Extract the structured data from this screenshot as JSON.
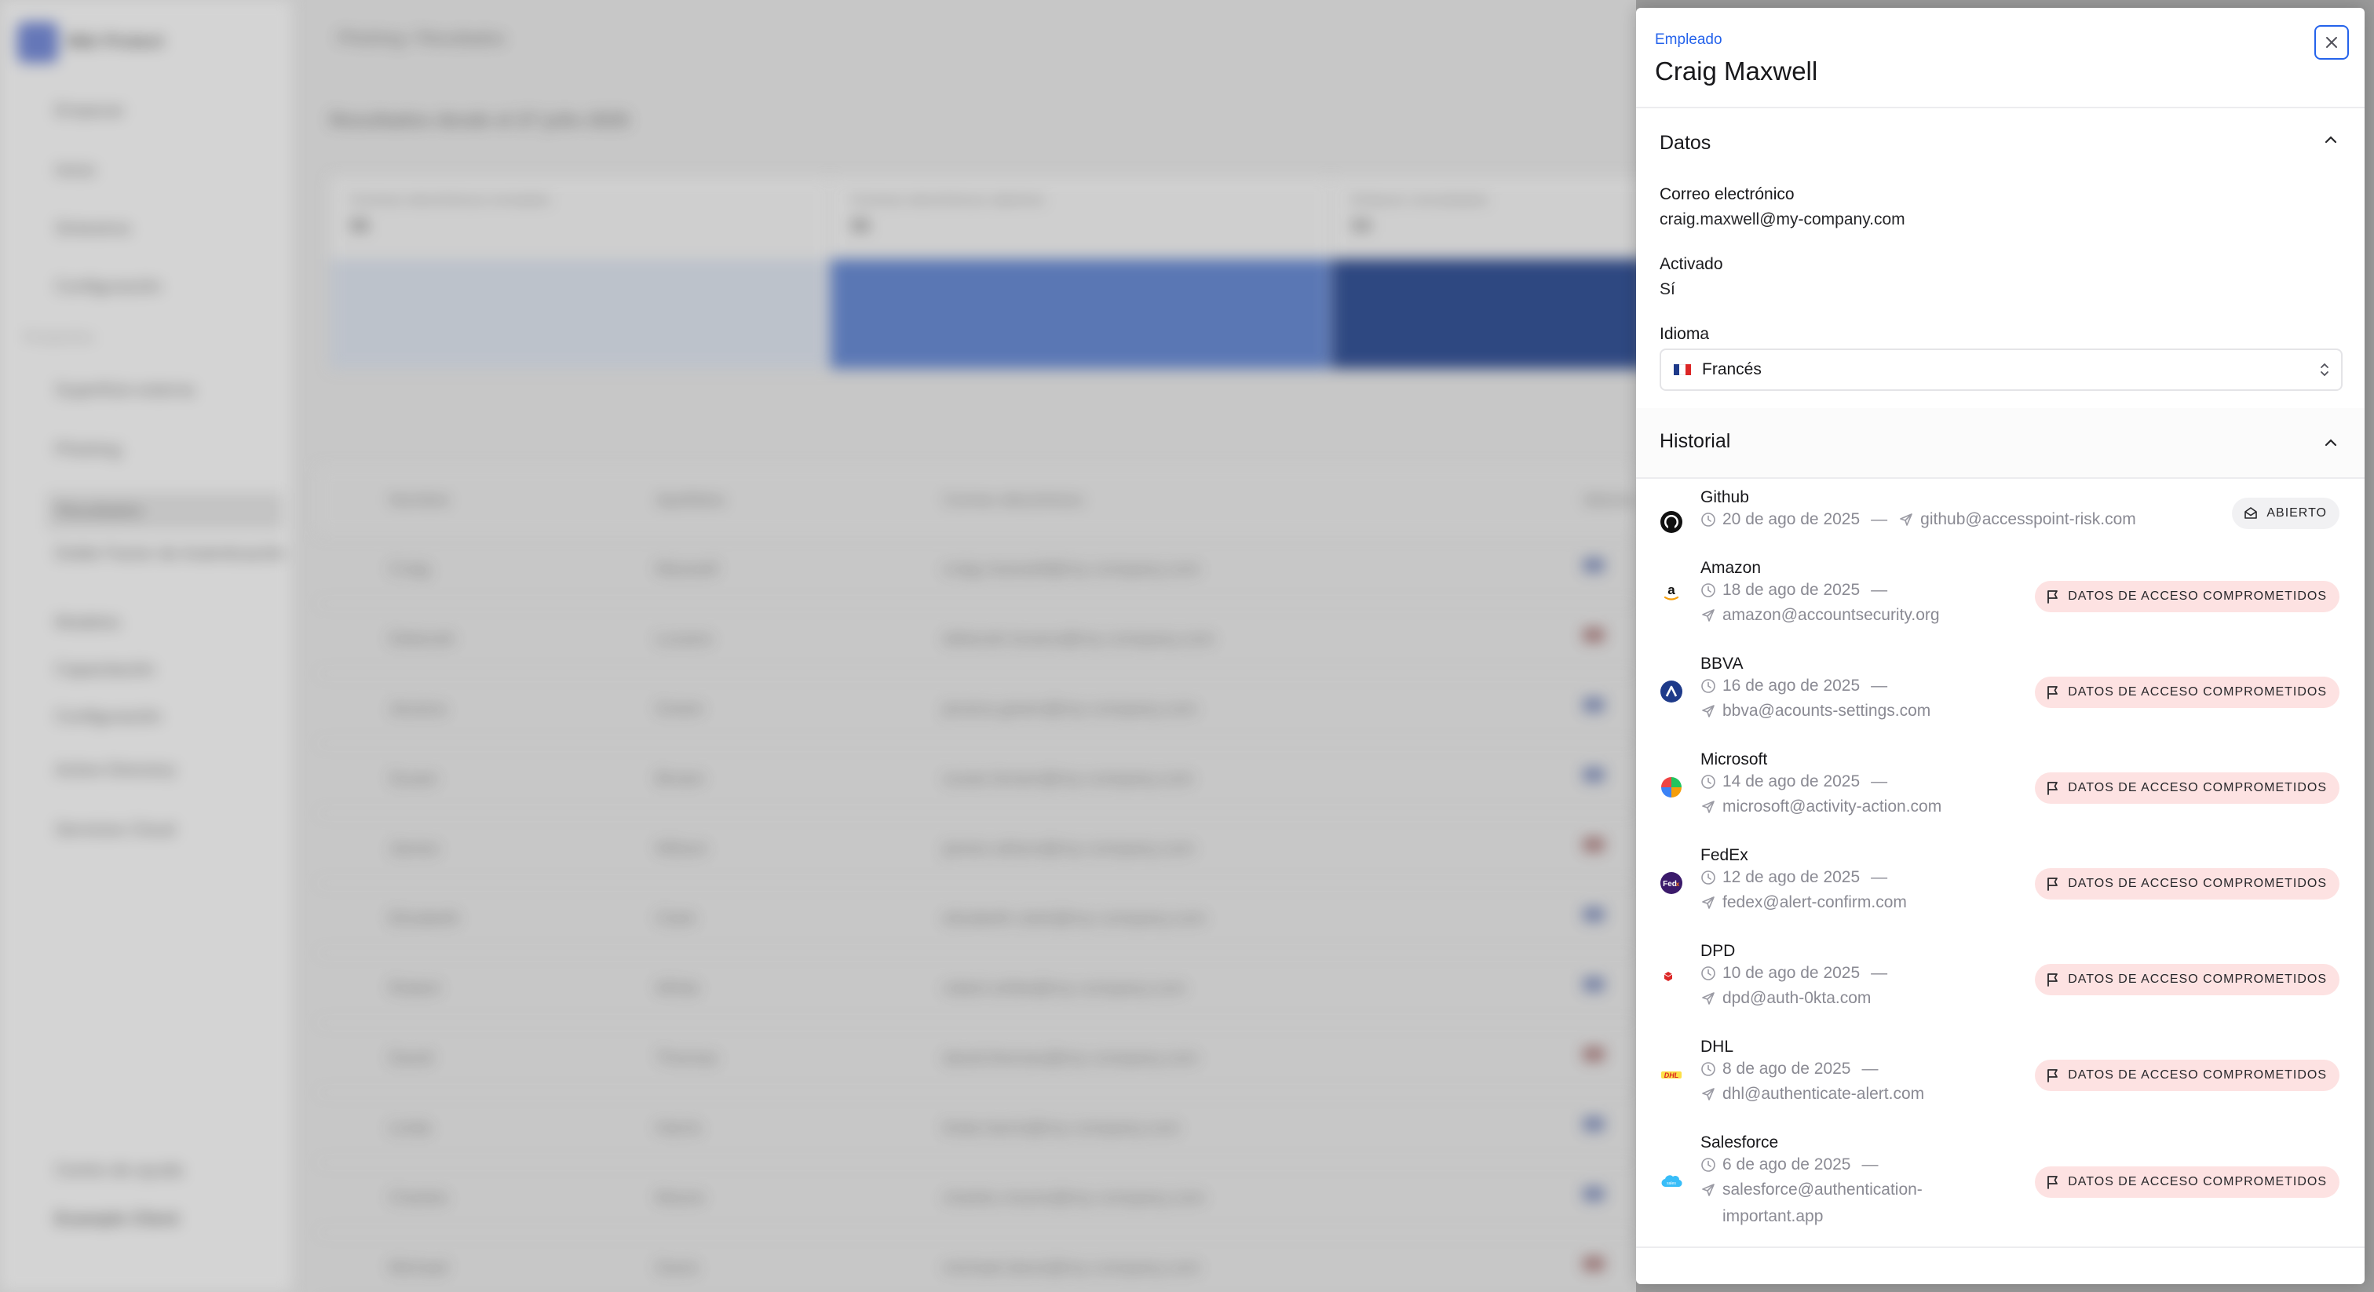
{
  "background": {
    "app_name": "Mdr Protect",
    "breadcrumb": "Phishing / Resultados",
    "nav": [
      "Empezar",
      "Inicio",
      "Siniestros",
      "Configuración",
      "Perspectiva",
      "Superficie externa",
      "Phishing",
      "Resultados",
      "Doble Factor de Autenticación",
      "Modelos",
      "Capacitación",
      "Configuración",
      "Active Directory",
      "Servicios Cloud"
    ],
    "help": "Centro de ayuda",
    "client_name": "Example Client",
    "main_title": "Resultados desde el 27 julio 2025",
    "stats": [
      {
        "label": "Correos electrónicos enviados",
        "value": "96"
      },
      {
        "label": "Correos electrónicos abiertos",
        "value": "96"
      },
      {
        "label": "Enlaces consultados",
        "value": "94"
      }
    ],
    "columns": [
      "Nombre",
      "Apellidos",
      "Correo electrónico",
      "Idioma"
    ],
    "rows": [
      [
        "Craig",
        "Maxwell",
        "craig.maxwell@my-company.com"
      ],
      [
        "Deborah",
        "Lozano",
        "deborah.lozano@my-company.com"
      ],
      [
        "Jessica",
        "Green",
        "jessica.green@my-company.com"
      ],
      [
        "Susan",
        "Brown",
        "susan.brown@my-company.com"
      ],
      [
        "James",
        "Wilson",
        "james.wilson@my-company.com"
      ],
      [
        "Elizabeth",
        "Clark",
        "elizabeth.clark@my-company.com"
      ],
      [
        "Robert",
        "White",
        "robert.white@my-company.com"
      ],
      [
        "David",
        "Thomas",
        "david.thomas@my-company.com"
      ],
      [
        "Linda",
        "Harris",
        "linda.harris@my-company.com"
      ],
      [
        "Charles",
        "Moore",
        "charles.moore@my-company.com"
      ],
      [
        "Michael",
        "Davis",
        "michael.davis@my-company.com"
      ]
    ]
  },
  "panel": {
    "type_label": "Empleado",
    "name": "Craig Maxwell",
    "datos": {
      "title": "Datos",
      "email_label": "Correo electrónico",
      "email_value": "craig.maxwell@my-company.com",
      "activated_label": "Activado",
      "activated_value": "Sí",
      "language_label": "Idioma",
      "language_value": "Francés"
    },
    "historial": {
      "title": "Historial",
      "items": [
        {
          "brand": "Github",
          "date": "20 de ago de 2025",
          "dash": "—",
          "sender": "github@accesspoint-risk.com",
          "badge": "ABIERTO",
          "icon": "github-icon"
        },
        {
          "brand": "Amazon",
          "date": "18 de ago de 2025",
          "dash": "—",
          "sender": "amazon@accountsecurity.org",
          "badge": "DATOS DE ACCESO COMPROMETIDOS",
          "icon": "amazon-icon"
        },
        {
          "brand": "BBVA",
          "date": "16 de ago de 2025",
          "dash": "—",
          "sender": "bbva@acounts-settings.com",
          "badge": "DATOS DE ACCESO COMPROMETIDOS",
          "icon": "bbva-icon"
        },
        {
          "brand": "Microsoft",
          "date": "14 de ago de 2025",
          "dash": "—",
          "sender": "microsoft@activity-action.com",
          "badge": "DATOS DE ACCESO COMPROMETIDOS",
          "icon": "microsoft-icon"
        },
        {
          "brand": "FedEx",
          "date": "12 de ago de 2025",
          "dash": "—",
          "sender": "fedex@alert-confirm.com",
          "badge": "DATOS DE ACCESO COMPROMETIDOS",
          "icon": "fedex-icon"
        },
        {
          "brand": "DPD",
          "date": "10 de ago de 2025",
          "dash": "—",
          "sender": "dpd@auth-0kta.com",
          "badge": "DATOS DE ACCESO COMPROMETIDOS",
          "icon": "dpd-icon"
        },
        {
          "brand": "DHL",
          "date": "8 de ago de 2025",
          "dash": "—",
          "sender": "dhl@authenticate-alert.com",
          "badge": "DATOS DE ACCESO COMPROMETIDOS",
          "icon": "dhl-icon"
        },
        {
          "brand": "Salesforce",
          "date": "6 de ago de 2025",
          "dash": "—",
          "sender": "salesforce@authentication-",
          "sender_cont": "important.app",
          "badge": "DATOS DE ACCESO COMPROMETIDOS",
          "icon": "salesforce-icon"
        }
      ]
    }
  },
  "colors": {
    "accent": "#2563eb",
    "danger_badge_bg": "#fde2e2",
    "neutral_badge_bg": "#f1f1f3",
    "flag_blue": "#1e3a8a",
    "flag_white": "#ffffff",
    "flag_red": "#dc2626"
  }
}
